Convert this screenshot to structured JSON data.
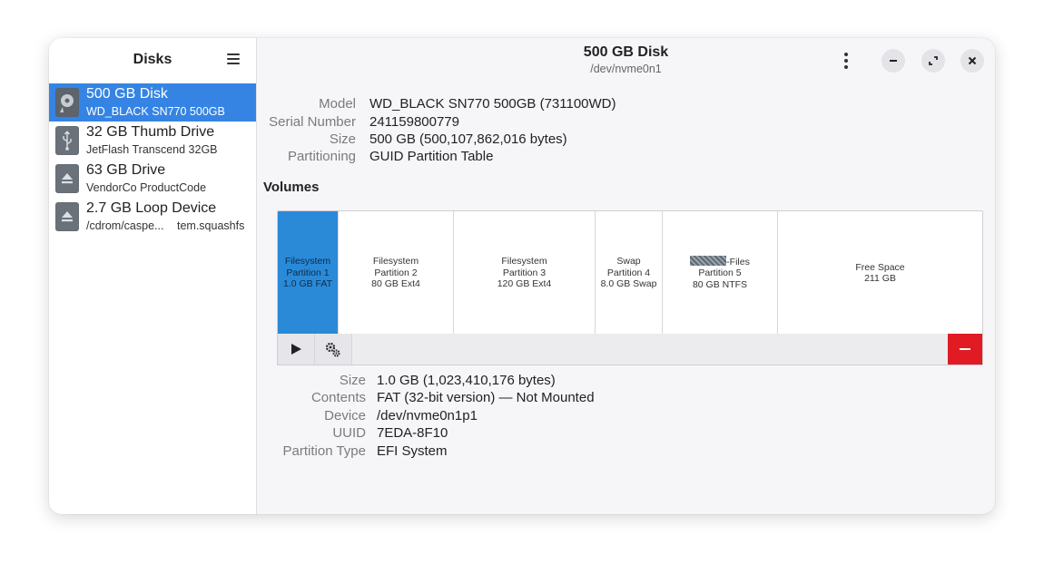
{
  "sidebar": {
    "title": "Disks",
    "drives": [
      {
        "name": "500 GB Disk",
        "sub": "WD_BLACK SN770 500GB",
        "icon": "disk-icon",
        "selected": true
      },
      {
        "name": "32 GB Thumb Drive",
        "sub": "JetFlash Transcend 32GB",
        "icon": "usb-icon"
      },
      {
        "name": "63 GB Drive",
        "sub": "VendorCo ProductCode",
        "icon": "eject-icon"
      },
      {
        "name": "2.7 GB Loop Device",
        "sub": "/cdrom/caspe...",
        "sub_tail": "tem.squashfs",
        "icon": "eject-icon"
      }
    ]
  },
  "header": {
    "title": "500 GB Disk",
    "subtitle": "/dev/nvme0n1"
  },
  "disk_info": [
    {
      "label": "Model",
      "value": "WD_BLACK SN770 500GB (731100WD)"
    },
    {
      "label": "Serial Number",
      "value": "241159800779"
    },
    {
      "label": "Size",
      "value": "500 GB (500,107,862,016 bytes)"
    },
    {
      "label": "Partitioning",
      "value": "GUID Partition Table"
    }
  ],
  "volumes": {
    "title": "Volumes",
    "partitions": [
      {
        "label": "Filesystem",
        "sub": "Partition 1",
        "size": "1.0 GB FAT",
        "selected": true
      },
      {
        "label": "Filesystem",
        "sub": "Partition 2",
        "size": "80 GB Ext4"
      },
      {
        "label": "Filesystem",
        "sub": "Partition 3",
        "size": "120 GB Ext4"
      },
      {
        "label": "Swap",
        "sub": "Partition 4",
        "size": "8.0 GB Swap"
      },
      {
        "label": "-Files",
        "sub": "Partition 5",
        "size": "80 GB NTFS"
      },
      {
        "label": "Free Space",
        "sub": "",
        "size": "211 GB"
      }
    ]
  },
  "partition_details": [
    {
      "label": "Size",
      "value": "1.0 GB (1,023,410,176 bytes)"
    },
    {
      "label": "Contents",
      "value": "FAT (32-bit version) — Not Mounted"
    },
    {
      "label": "Device",
      "value": "/dev/nvme0n1p1"
    },
    {
      "label": "UUID",
      "value": "7EDA-8F10"
    },
    {
      "label": "Partition Type",
      "value": "EFI System"
    }
  ],
  "colors": {
    "accent": "#3584e4",
    "selected_partition": "#2a8ad8",
    "destructive": "#e01b24"
  }
}
